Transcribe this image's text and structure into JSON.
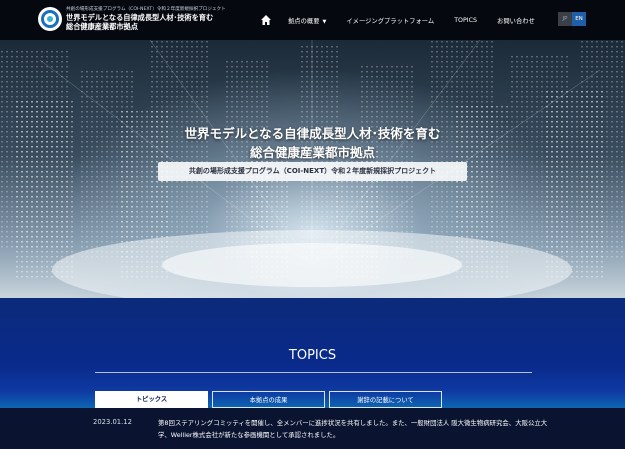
{
  "header": {
    "logo_small": "共創の場形成支援プログラム（COI-NEXT）令和２年度新規採択プロジェクト",
    "logo_line1": "世界モデルとなる自律成長型人材･技術を育む",
    "logo_line2": "総合健康産業都市拠点"
  },
  "nav": {
    "home_icon": "home-icon",
    "items": [
      {
        "label": "拠点の概要",
        "caret": "▼"
      },
      {
        "label": "イメージングプラットフォーム"
      },
      {
        "label": "TOPICS"
      },
      {
        "label": "お問い合わせ"
      }
    ],
    "lang_jp": "JP",
    "lang_en": "EN"
  },
  "hero": {
    "title_line1": "世界モデルとなる自律成長型人材･技術を育む",
    "title_line2": "総合健康産業都市拠点",
    "badge": "共創の場形成支援プログラム（COI-NEXT）令和２年度新規採択プロジェクト"
  },
  "topics": {
    "title": "TOPICS",
    "tabs": [
      "トピックス",
      "本拠点の成果",
      "謝辞の記載について"
    ],
    "news": [
      {
        "date": "2023.01.12",
        "text": "第8回ステアリングコミッティを開催し、全メンバーに進捗状況を共有しました。また、一般財団法人 阪大微生物病研究会、大阪公立大学、Wellier株式会社が新たな参画機関として承認されました。"
      }
    ]
  },
  "colors": {
    "header_bg": "#05080f",
    "accent_blue": "#1f5fa8",
    "topics_bg": "#0a2a8c"
  }
}
